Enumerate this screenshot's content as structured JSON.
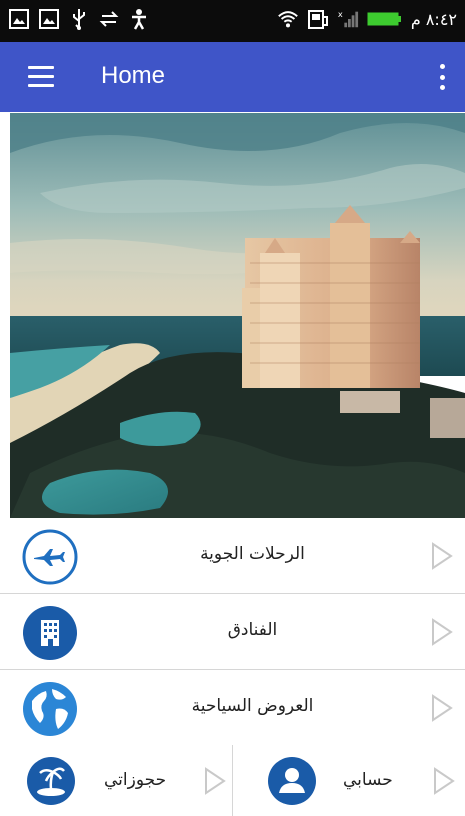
{
  "status_bar": {
    "time": "٨:٤٢ م",
    "icons_left": [
      "gallery-icon",
      "gallery-icon",
      "usb-icon",
      "sync-icon",
      "accessibility-icon"
    ],
    "icons_right": [
      "wifi-icon",
      "battery-saver-icon",
      "signal-icon",
      "battery-icon"
    ]
  },
  "app_bar": {
    "title": "Home",
    "color": "#3f55c8"
  },
  "menu": [
    {
      "label": "الرحلات الجوية",
      "icon": "airplane-icon"
    },
    {
      "label": "الفنادق",
      "icon": "hotel-icon"
    },
    {
      "label": "العروض السياحية",
      "icon": "globe-icon"
    }
  ],
  "bottom": {
    "left": {
      "label": "حجوزاتي",
      "icon": "island-icon"
    },
    "right": {
      "label": "حسابي",
      "icon": "user-icon"
    }
  },
  "colors": {
    "accent": "#1f6fc0",
    "accent_dark": "#1a5ba8",
    "arrow": "#c9c9c9"
  }
}
